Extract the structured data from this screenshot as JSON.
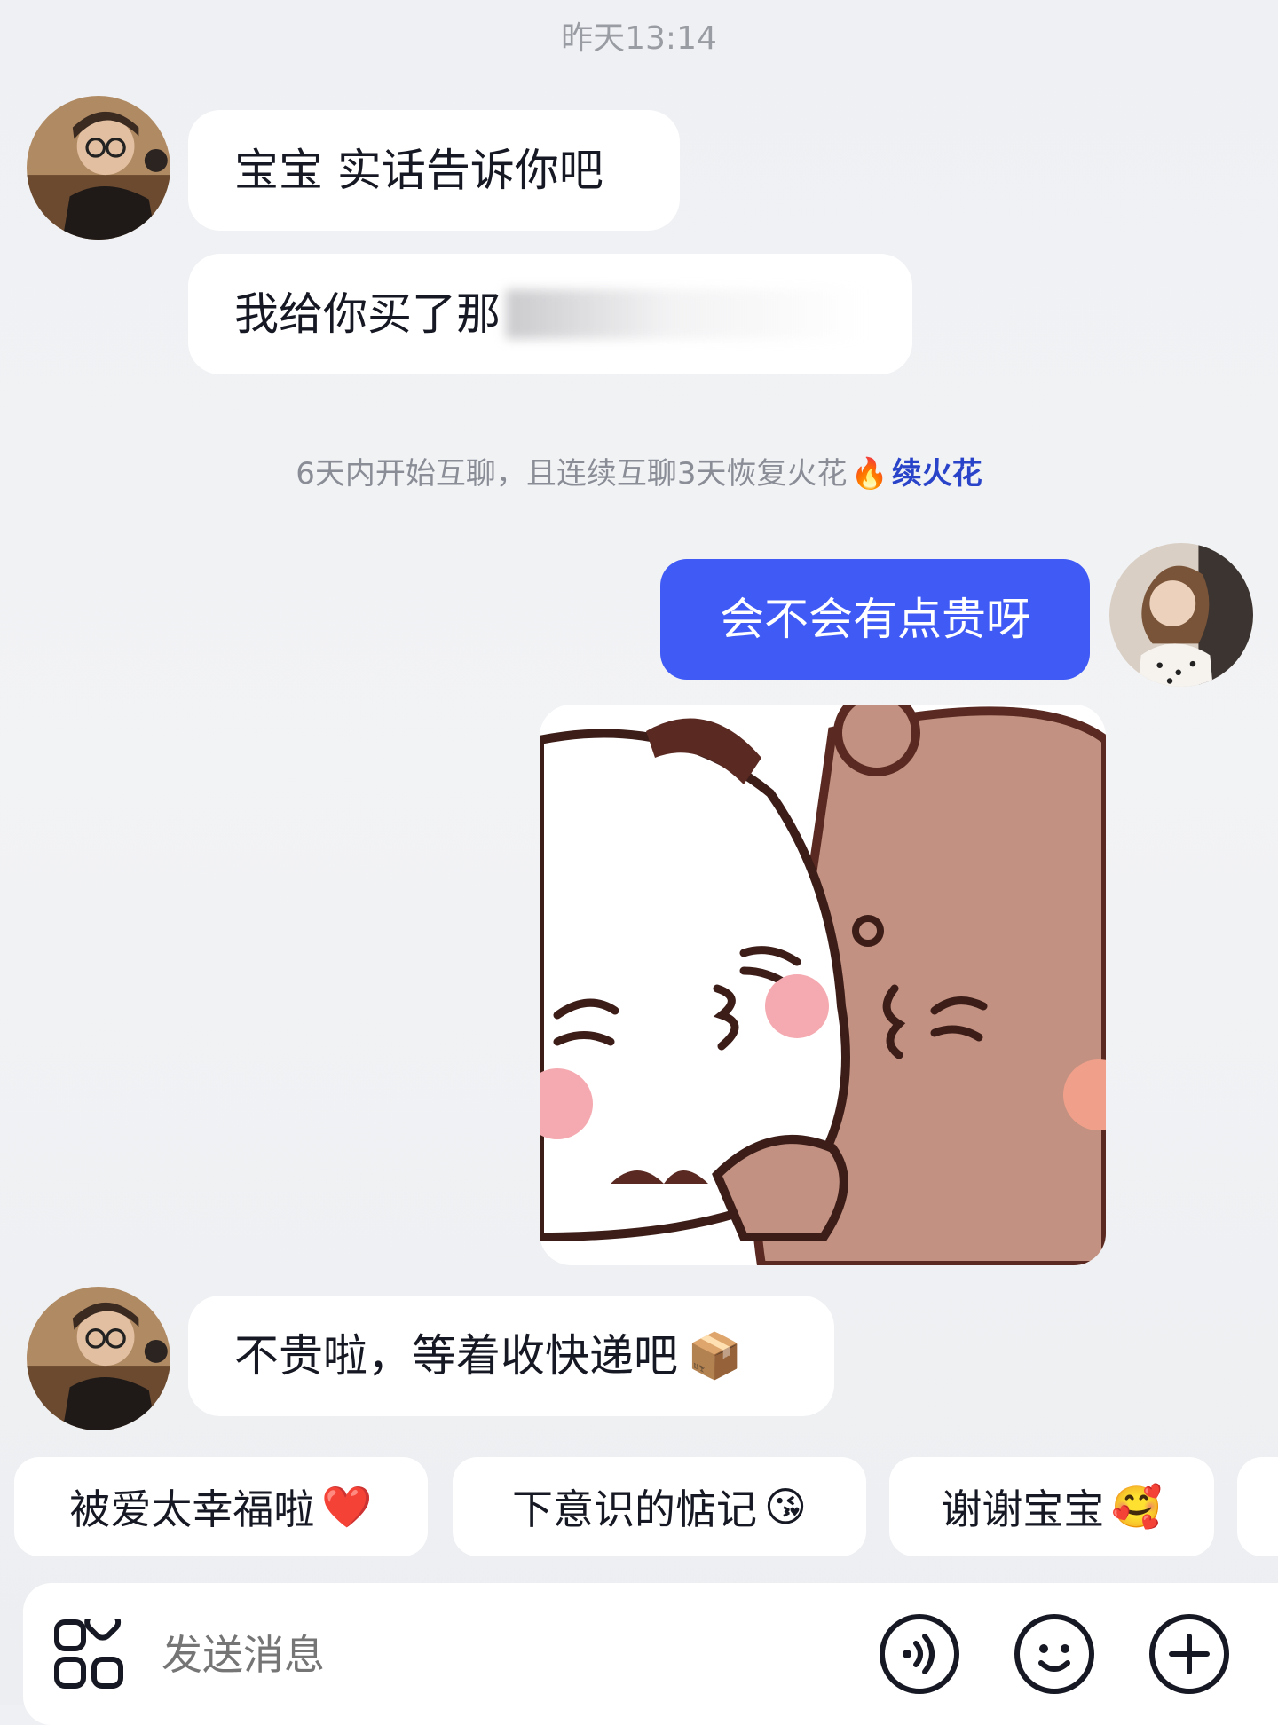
{
  "timestamp": "昨天13:14",
  "messages": [
    {
      "text": "宝宝 实话告诉你吧"
    },
    {
      "text": "我给你买了那"
    },
    {
      "text": "会不会有点贵呀"
    },
    {
      "text": "不贵啦，等着收快递吧",
      "emoji": "📦"
    }
  ],
  "system_tip": {
    "text": "6天内开始互聊，且连续互聊3天恢复火花",
    "emoji": "🔥",
    "link": "续火花"
  },
  "quick_replies": [
    {
      "label": "被爱太幸福啦",
      "emoji": "❤️"
    },
    {
      "label": "下意识的惦记",
      "emoji": "😘"
    },
    {
      "label": "谢谢宝宝",
      "emoji": "🥰"
    }
  ],
  "input": {
    "placeholder": "发送消息"
  },
  "icons": {
    "apps": "apps-grid-icon",
    "voice": "voice-icon",
    "emoji": "emoji-icon",
    "plus": "plus-icon"
  },
  "colors": {
    "sent_bubble": "#3f5af5",
    "link": "#2a44c9",
    "background": "#eef0f3"
  }
}
